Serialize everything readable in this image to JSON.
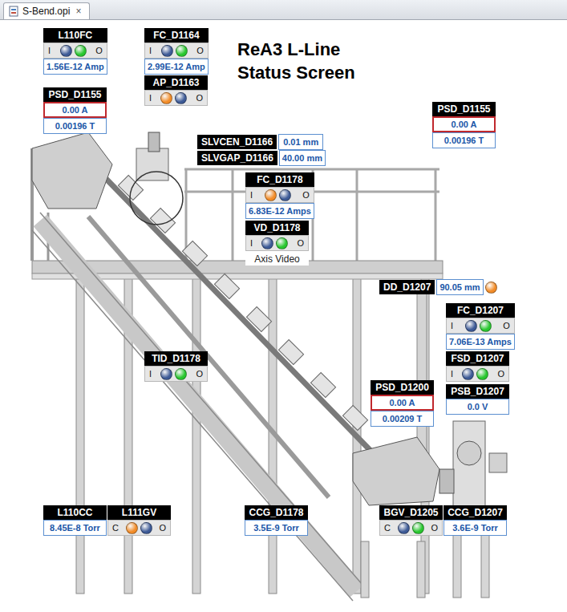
{
  "tab": {
    "label": "S-Bend.opi",
    "close": "×",
    "selected": true
  },
  "title": [
    "ReA3 L-Line",
    "Status Screen"
  ],
  "widgets": [
    {
      "kind": "stack",
      "label": "L110FC",
      "toggle": {
        "left": "I",
        "right": "O",
        "lamps": [
          {
            "color": "#3d5a96"
          },
          {
            "color": "#29c72f"
          }
        ]
      },
      "values": [
        {
          "text": "1.56E-12 Amp",
          "alarm": false
        }
      ]
    },
    {
      "kind": "stack",
      "label": "FC_D1164",
      "toggle": {
        "left": "I",
        "right": "O",
        "lamps": [
          {
            "color": "#3d5a96"
          },
          {
            "color": "#29c72f"
          }
        ]
      },
      "values": [
        {
          "text": "2.99E-12 Amp",
          "alarm": false
        }
      ]
    },
    {
      "kind": "stack",
      "label": "AP_D1163",
      "toggle": {
        "left": "I",
        "right": "O",
        "lamps": [
          {
            "color": "#f28c28"
          },
          {
            "color": "#3d5a96"
          }
        ]
      },
      "values": []
    },
    {
      "kind": "stack",
      "label": "PSD_D1155",
      "values": [
        {
          "text": "0.00 A",
          "alarm": true
        },
        {
          "text": "0.00196 T",
          "alarm": false
        }
      ]
    },
    {
      "kind": "stack",
      "label": "PSD_D1155",
      "values": [
        {
          "text": "0.00 A",
          "alarm": true
        },
        {
          "text": "0.00196 T",
          "alarm": false
        }
      ]
    },
    {
      "kind": "inline",
      "label": "SLVCEN_D1166",
      "values": [
        {
          "text": "0.01 mm",
          "alarm": false
        }
      ]
    },
    {
      "kind": "inline",
      "label": "SLVGAP_D1166",
      "values": [
        {
          "text": "40.00 mm",
          "alarm": false
        }
      ]
    },
    {
      "kind": "stack",
      "label": "FC_D1178",
      "toggle": {
        "left": "I",
        "right": "O",
        "lamps": [
          {
            "color": "#f28c28"
          },
          {
            "color": "#3d5a96"
          }
        ]
      },
      "values": [
        {
          "text": "6.83E-12 Amps",
          "alarm": false
        }
      ]
    },
    {
      "kind": "stack",
      "label": "VD_D1178",
      "toggle": {
        "left": "I",
        "right": "O",
        "lamps": [
          {
            "color": "#3d5a96"
          },
          {
            "color": "#29c72f"
          }
        ]
      },
      "values": [],
      "caption": "Axis Video"
    },
    {
      "kind": "inline",
      "label": "DD_D1207",
      "values": [
        {
          "text": "90.05 mm",
          "alarm": false
        }
      ],
      "lamp": {
        "color": "#f28c28"
      }
    },
    {
      "kind": "stack",
      "label": "FC_D1207",
      "toggle": {
        "left": "I",
        "right": "O",
        "lamps": [
          {
            "color": "#3d5a96"
          },
          {
            "color": "#29c72f"
          }
        ]
      },
      "values": [
        {
          "text": "7.06E-13 Amps",
          "alarm": false
        }
      ]
    },
    {
      "kind": "stack",
      "label": "FSD_D1207",
      "toggle": {
        "left": "I",
        "right": "O",
        "lamps": [
          {
            "color": "#3d5a96"
          },
          {
            "color": "#29c72f"
          }
        ]
      },
      "values": []
    },
    {
      "kind": "stack",
      "label": "PSB_D1207",
      "values": [
        {
          "text": "0.0 V",
          "alarm": false
        }
      ]
    },
    {
      "kind": "stack",
      "label": "TID_D1178",
      "toggle": {
        "left": "I",
        "right": "O",
        "lamps": [
          {
            "color": "#3d5a96"
          },
          {
            "color": "#29c72f"
          }
        ]
      },
      "values": []
    },
    {
      "kind": "stack",
      "label": "PSD_D1200",
      "values": [
        {
          "text": "0.00 A",
          "alarm": true
        },
        {
          "text": "0.00209 T",
          "alarm": false
        }
      ]
    },
    {
      "kind": "stack",
      "label": "L110CC",
      "values": [
        {
          "text": "8.45E-8 Torr",
          "alarm": false
        }
      ]
    },
    {
      "kind": "stack",
      "label": "L111GV",
      "toggle": {
        "left": "C",
        "right": "O",
        "lamps": [
          {
            "color": "#f28c28"
          },
          {
            "color": "#3d5a96"
          }
        ]
      },
      "values": []
    },
    {
      "kind": "stack",
      "label": "CCG_D1178",
      "values": [
        {
          "text": "3.5E-9 Torr",
          "alarm": false
        }
      ]
    },
    {
      "kind": "stack",
      "label": "BGV_D1205",
      "toggle": {
        "left": "C",
        "right": "O",
        "lamps": [
          {
            "color": "#3d5a96"
          },
          {
            "color": "#29c72f"
          }
        ]
      },
      "values": []
    },
    {
      "kind": "stack",
      "label": "CCG_D1207",
      "values": [
        {
          "text": "3.6E-9 Torr",
          "alarm": false
        }
      ]
    }
  ]
}
